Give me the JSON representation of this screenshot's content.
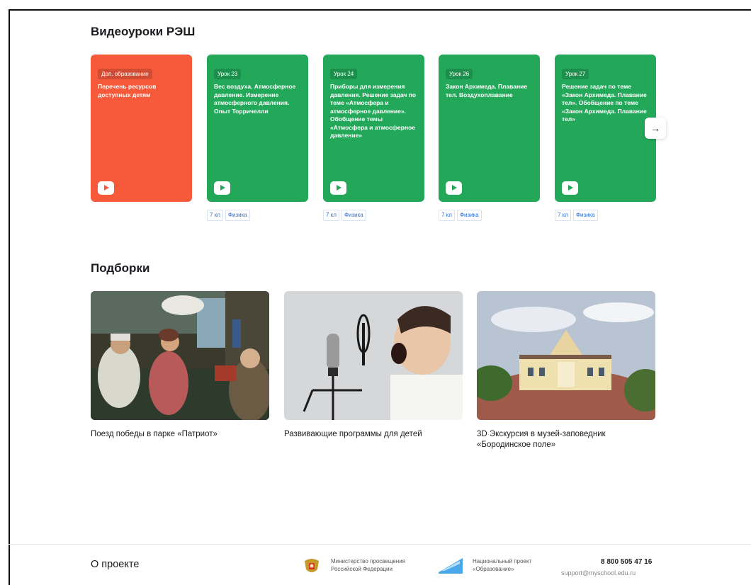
{
  "video_lessons": {
    "title": "Видеоуроки РЭШ",
    "cards": [
      {
        "badge": "Доп. образование",
        "text": "Перечень ресурсов доступных детям",
        "color": "#f65a3b",
        "tags": []
      },
      {
        "badge": "Урок 23",
        "text": "Вес воздуха. Атмосферное давление. Измерение атмосферного давления. Опыт Торричелли",
        "color": "#23a85a",
        "tags": [
          "7 кл",
          "Физика"
        ]
      },
      {
        "badge": "Урок 24",
        "text": "Приборы для измерения давления. Решение задач по теме «Атмосфера и атмосферное давление». Обобщение темы «Атмосфера и атмосферное давление»",
        "color": "#23a85a",
        "tags": [
          "7 кл",
          "Физика"
        ]
      },
      {
        "badge": "Урок 26",
        "text": "Закон Архимеда. Плавание тел. Воздухоплавание",
        "color": "#23a85a",
        "tags": [
          "7 кл",
          "Физика"
        ]
      },
      {
        "badge": "Урок 27",
        "text": "Решение задач по теме «Закон Архимеда. Плавание тел». Обобщение по теме «Закон Архимеда. Плавание тел»",
        "color": "#23a85a",
        "tags": [
          "7 кл",
          "Физика"
        ]
      }
    ],
    "next_icon": "arrow-right-icon"
  },
  "collections": {
    "title": "Подборки",
    "items": [
      {
        "title": "Поезд победы в парке «Патриот»"
      },
      {
        "title": "Развивающие программы для детей"
      },
      {
        "title": "3D Экскурсия в музей-заповедник «Бородинское поле»"
      }
    ]
  },
  "footer": {
    "title": "О проекте",
    "ministry": "Министерство просвещения Российской Федерации",
    "project": "Национальный проект «Образование»",
    "phone": "8 800 505 47 16",
    "email": "support@myschool.edu.ru"
  }
}
